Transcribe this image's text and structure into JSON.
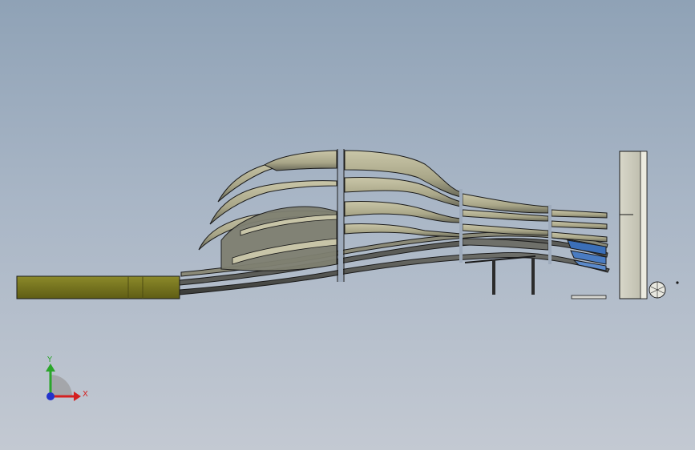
{
  "viewport": {
    "background_top": "#8fa2b6",
    "background_bottom": "#c3c9d2"
  },
  "model": {
    "description_color_base": "#7d7a1c",
    "shell_fill": "#b7b49a",
    "shell_shadow": "#4d4e4a",
    "highlight_blue": "#3b6fb8",
    "edge_color": "#1a1a1a"
  },
  "triad": {
    "y_label": "Y",
    "x_label": "X",
    "y_color": "#2aa62a",
    "x_color": "#d42020",
    "z_color": "#2233cc"
  }
}
